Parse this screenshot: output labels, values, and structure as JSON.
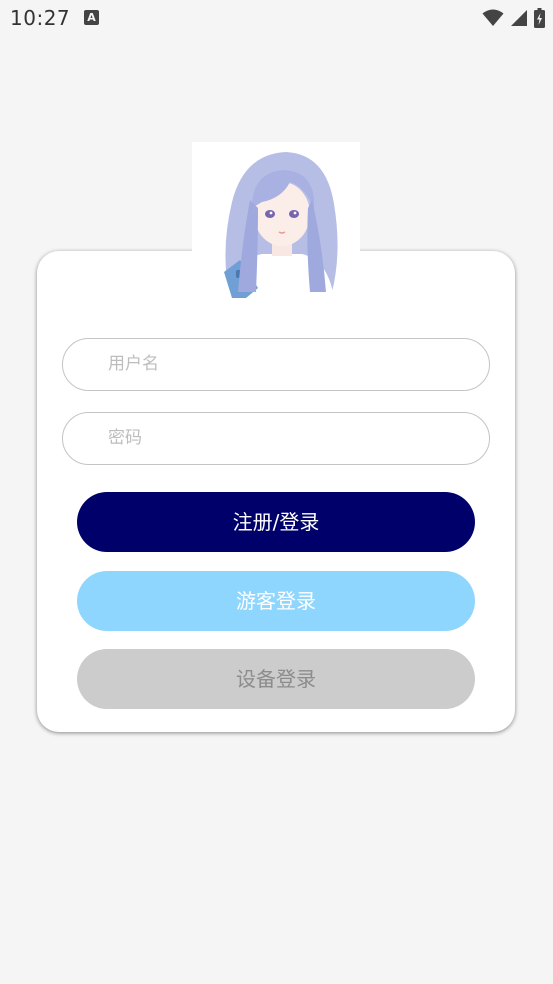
{
  "status_bar": {
    "time": "10:27",
    "notification_icon": "text-a-icon",
    "icons": [
      "wifi-icon",
      "cell-signal-icon",
      "battery-charging-icon"
    ]
  },
  "avatar": {
    "icon": "anime-girl-avatar"
  },
  "form": {
    "username_placeholder": "用户名",
    "password_placeholder": "密码"
  },
  "buttons": {
    "login_label": "注册/登录",
    "guest_label": "游客登录",
    "device_label": "设备登录"
  },
  "colors": {
    "background": "#f5f5f5",
    "login_button_bg": "#00006b",
    "login_button_text": "#ffffff",
    "guest_button_bg": "#8fd6fe",
    "guest_button_text": "#ffffff",
    "device_button_bg": "#cccccc",
    "device_button_text": "#8c8c8c",
    "field_border": "#c4c4c4",
    "placeholder_text": "#bdbdbd"
  }
}
